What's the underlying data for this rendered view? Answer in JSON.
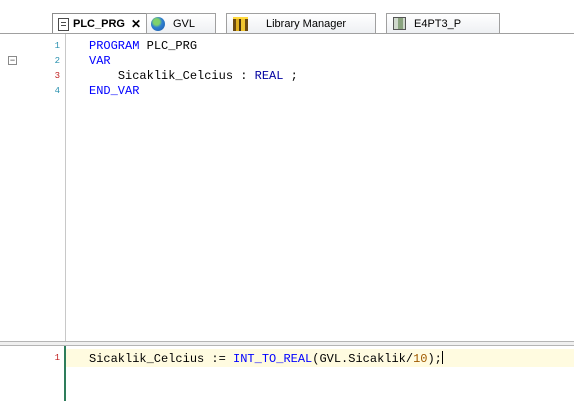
{
  "tabs": [
    {
      "label": "PLC_PRG",
      "icon": "program-document-icon",
      "active": true,
      "close_glyph": "✕"
    },
    {
      "label": "GVL",
      "icon": "globe-icon",
      "active": false
    },
    {
      "label": "Library Manager",
      "icon": "library-books-icon",
      "active": false
    },
    {
      "label": "E4PT3_P",
      "icon": "device-icon",
      "active": false
    }
  ],
  "declaration": {
    "fold_glyph": "−",
    "lines": [
      {
        "num": "1",
        "keyword": "PROGRAM",
        "rest": " PLC_PRG"
      },
      {
        "num": "2",
        "keyword": "VAR",
        "rest": ""
      },
      {
        "num": "3",
        "indent": "    ",
        "name": "Sicaklik_Celcius",
        "sep": " : ",
        "type": "REAL",
        "end": " ;"
      },
      {
        "num": "4",
        "keyword": "END_VAR",
        "rest": ""
      }
    ]
  },
  "implementation": {
    "lines": [
      {
        "num": "1",
        "target": "Sicaklik_Celcius",
        "op": " := ",
        "func": "INT_TO_REAL",
        "open": "(",
        "arg": "GVL.Sicaklik",
        "div": "/",
        "literal": "10",
        "close": ");"
      }
    ]
  },
  "colors": {
    "keyword": "#0000ff",
    "type": "#0000a0",
    "line_number": "#2b91af",
    "modified_line_number": "#c02020",
    "active_line_bg": "#fffbe0"
  }
}
